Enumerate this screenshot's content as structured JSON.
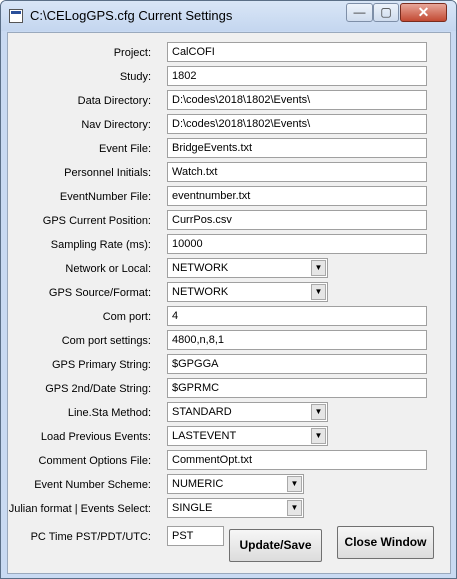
{
  "window": {
    "title": "C:\\CELogGPS.cfg Current Settings",
    "minimize_glyph": "—",
    "maximize_glyph": "▢",
    "close_glyph": "✕"
  },
  "fields": [
    {
      "label": "Project:",
      "value": "CalCOFI"
    },
    {
      "label": "Study:",
      "value": "1802"
    },
    {
      "label": "Data Directory:",
      "value": "D:\\codes\\2018\\1802\\Events\\"
    },
    {
      "label": "Nav Directory:",
      "value": "D:\\codes\\2018\\1802\\Events\\"
    },
    {
      "label": "Event File:",
      "value": "BridgeEvents.txt"
    },
    {
      "label": "Personnel Initials:",
      "value": "Watch.txt"
    },
    {
      "label": "EventNumber File:",
      "value": "eventnumber.txt"
    },
    {
      "label": "GPS Current Position:",
      "value": "CurrPos.csv"
    },
    {
      "label": "Sampling Rate (ms):",
      "value": "10000"
    },
    {
      "label": "Network or Local:",
      "value": "NETWORK"
    },
    {
      "label": "GPS Source/Format:",
      "value": "NETWORK"
    },
    {
      "label": "Com port:",
      "value": "4"
    },
    {
      "label": "Com port settings:",
      "value": "4800,n,8,1"
    },
    {
      "label": "GPS Primary String:",
      "value": "$GPGGA"
    },
    {
      "label": "GPS 2nd/Date String:",
      "value": "$GPRMC"
    },
    {
      "label": "Line.Sta Method:",
      "value": "STANDARD"
    },
    {
      "label": "Load Previous Events:",
      "value": "LASTEVENT"
    },
    {
      "label": "Comment Options File:",
      "value": "CommentOpt.txt"
    },
    {
      "label": "Event Number Scheme:",
      "value": "NUMERIC"
    },
    {
      "label": "Julian format | Events Select:",
      "value": "SINGLE"
    },
    {
      "label": "PC Time PST/PDT/UTC:",
      "value": "PST"
    }
  ],
  "buttons": {
    "update": "Update/Save",
    "close": "Close Window"
  },
  "icons": {
    "app": "window-icon",
    "dropdown": "chevron-down-icon"
  }
}
